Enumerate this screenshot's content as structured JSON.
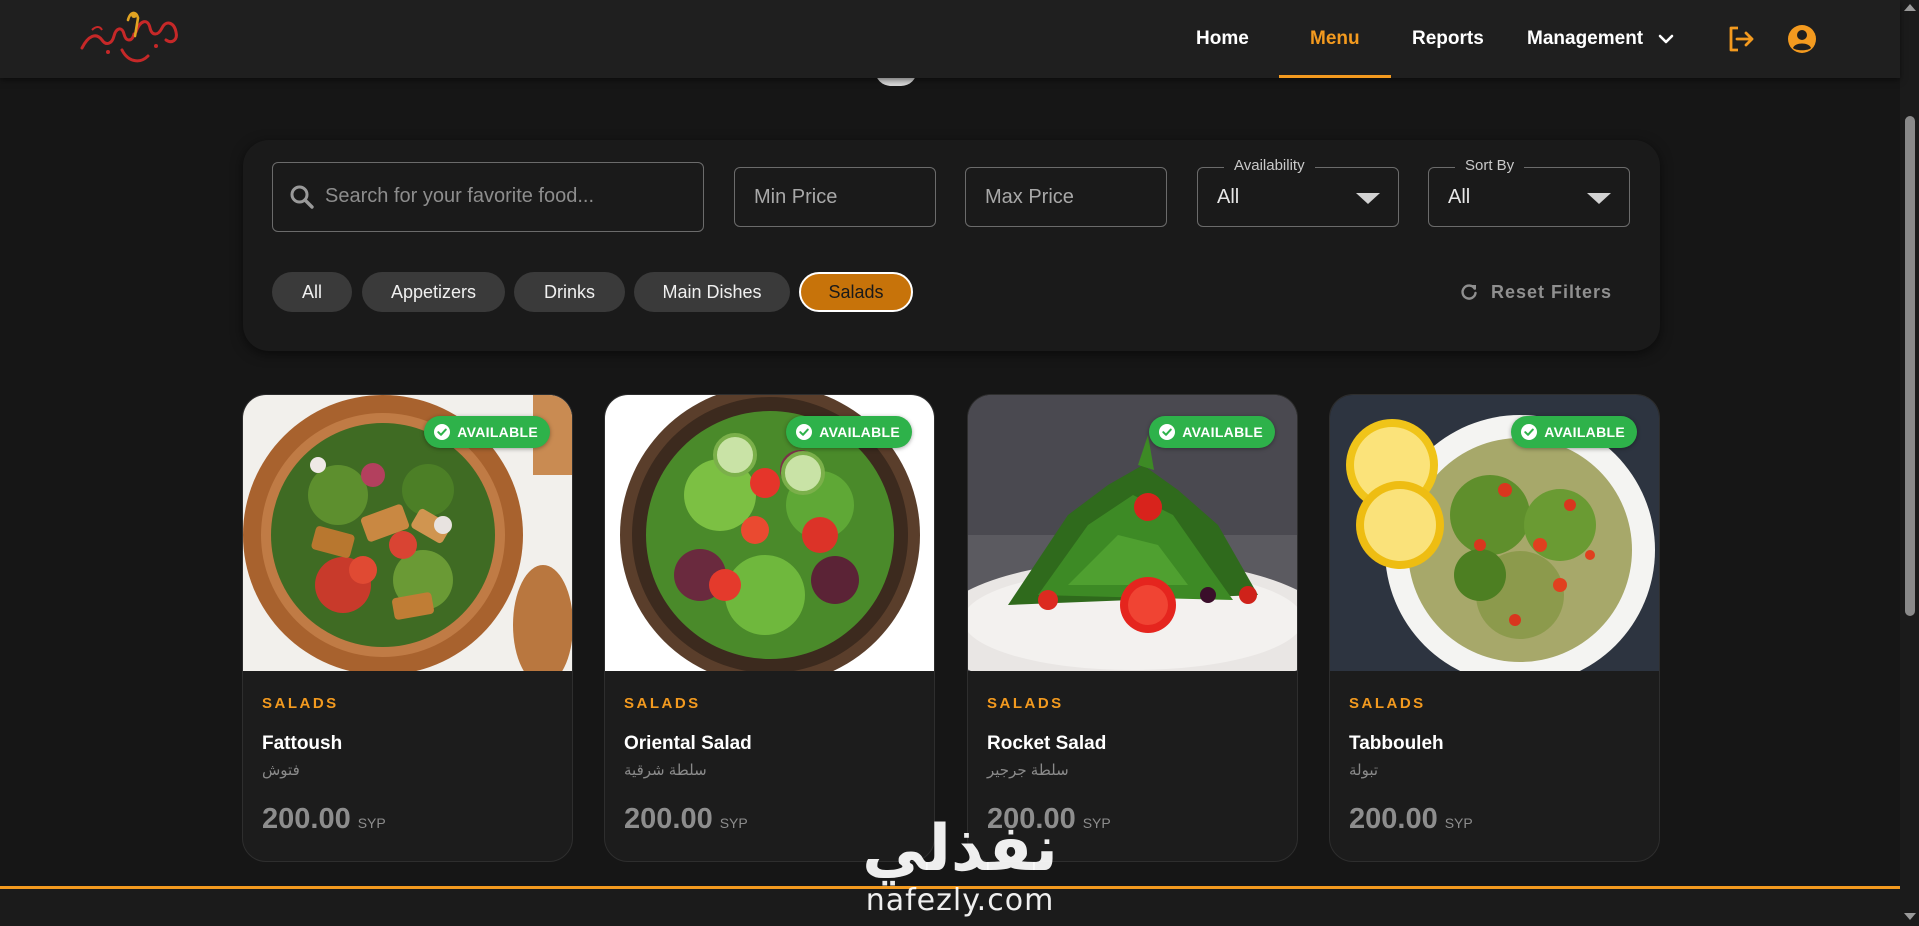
{
  "brand": {
    "logo_text": "منداي مسوق",
    "accent_color": "#f39a1f"
  },
  "nav": {
    "items": [
      {
        "label": "Home",
        "active": false
      },
      {
        "label": "Menu",
        "active": true
      },
      {
        "label": "Reports",
        "active": false
      },
      {
        "label": "Management",
        "active": false,
        "has_dropdown": true
      }
    ],
    "icons": [
      "logout-icon",
      "account-circle-icon"
    ]
  },
  "filters": {
    "search_placeholder": "Search for your favorite food...",
    "min_price_placeholder": "Min Price",
    "max_price_placeholder": "Max Price",
    "availability": {
      "label": "Availability",
      "value": "All"
    },
    "sort_by": {
      "label": "Sort By",
      "value": "All"
    },
    "categories": [
      {
        "label": "All",
        "active": false
      },
      {
        "label": "Appetizers",
        "active": false
      },
      {
        "label": "Drinks",
        "active": false
      },
      {
        "label": "Main Dishes",
        "active": false
      },
      {
        "label": "Salads",
        "active": true
      }
    ],
    "reset_label": "Reset Filters"
  },
  "products": [
    {
      "category": "SALADS",
      "name": "Fattoush",
      "name_ar": "فتوش",
      "price": "200.00",
      "currency": "SYP",
      "availability": "AVAILABLE"
    },
    {
      "category": "SALADS",
      "name": "Oriental Salad",
      "name_ar": "سلطة شرقية",
      "price": "200.00",
      "currency": "SYP",
      "availability": "AVAILABLE"
    },
    {
      "category": "SALADS",
      "name": "Rocket Salad",
      "name_ar": "سلطة جرجير",
      "price": "200.00",
      "currency": "SYP",
      "availability": "AVAILABLE"
    },
    {
      "category": "SALADS",
      "name": "Tabbouleh",
      "name_ar": "تبولة",
      "price": "200.00",
      "currency": "SYP",
      "availability": "AVAILABLE"
    }
  ],
  "watermark": {
    "arabic": "نفذلي",
    "latin": "nafezly.com"
  },
  "colors": {
    "background": "#161616",
    "navbar": "#1f1f1f",
    "available_badge": "#2eb24a",
    "active_chip": "#c7730a"
  }
}
